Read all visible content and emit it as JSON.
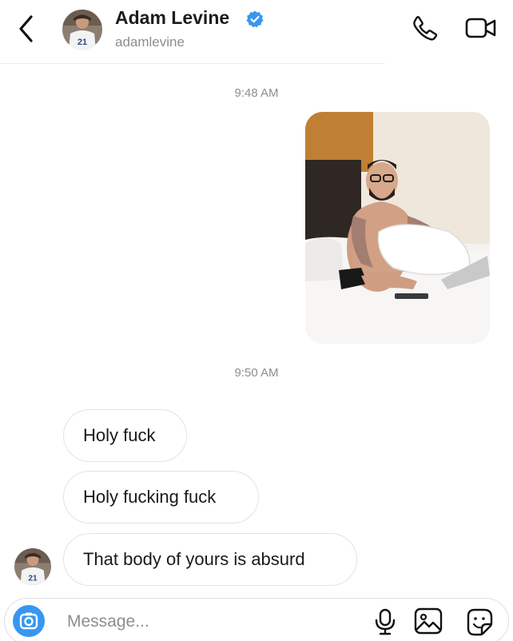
{
  "header": {
    "display_name": "Adam Levine",
    "username": "adamlevine",
    "verified": true
  },
  "icons": {
    "back": "chevron-left-icon",
    "verified": "verified-badge-icon",
    "call": "phone-icon",
    "video": "video-camera-icon",
    "camera": "camera-icon",
    "mic": "microphone-icon",
    "gallery": "image-icon",
    "sticker": "sticker-icon"
  },
  "thread": {
    "timestamp_1": "9:48 AM",
    "timestamp_2": "9:50 AM",
    "messages": [
      {
        "text": "Holy fuck"
      },
      {
        "text": "Holy fucking fuck"
      },
      {
        "text": "That body of yours is absurd"
      }
    ]
  },
  "composer": {
    "placeholder": "Message..."
  },
  "colors": {
    "accent": "#3797f0",
    "verified": "#3897f0",
    "secondary_text": "#8e8e8e",
    "bubble_border": "#e3e3e3"
  }
}
